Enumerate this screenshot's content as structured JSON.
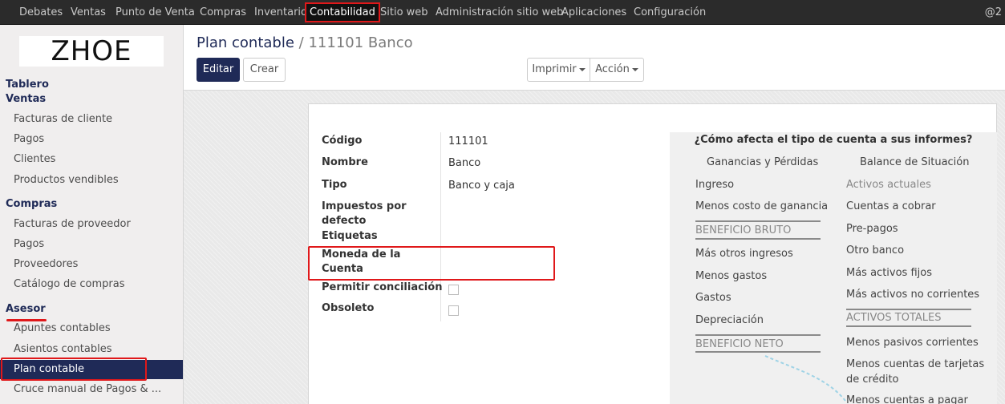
{
  "topbar": {
    "menus": [
      {
        "label": "Debates"
      },
      {
        "label": "Ventas"
      },
      {
        "label": "Punto de Venta"
      },
      {
        "label": "Compras"
      },
      {
        "label": "Inventario"
      },
      {
        "label": "Contabilidad"
      },
      {
        "label": "Sitio web"
      },
      {
        "label": "Administración sitio web"
      },
      {
        "label": "Aplicaciones"
      },
      {
        "label": "Configuración"
      }
    ],
    "user": "@2"
  },
  "sidebar": {
    "logo": "ZHOE",
    "sections": {
      "tablero": "Tablero",
      "ventas": "Ventas",
      "compras": "Compras",
      "asesor": "Asesor"
    },
    "ventas_items": [
      "Facturas de cliente",
      "Pagos",
      "Clientes",
      "Productos vendibles"
    ],
    "compras_items": [
      "Facturas de proveedor",
      "Pagos",
      "Proveedores",
      "Catálogo de compras"
    ],
    "asesor_items": [
      "Apuntes contables",
      "Asientos contables",
      "Plan contable",
      "Cruce manual de Pagos & ..."
    ]
  },
  "breadcrumb": {
    "parent": "Plan contable",
    "sep": "/",
    "current": "111101 Banco"
  },
  "toolbar": {
    "edit": "Editar",
    "create": "Crear",
    "print": "Imprimir",
    "action": "Acción"
  },
  "form": {
    "codigo_label": "Código",
    "codigo_value": "111101",
    "nombre_label": "Nombre",
    "nombre_value": "Banco",
    "tipo_label": "Tipo",
    "tipo_value": "Banco y caja",
    "impuestos_label_1": "Impuestos por",
    "impuestos_label_2": "defecto",
    "etiquetas_label": "Etiquetas",
    "moneda_label_1": "Moneda de la",
    "moneda_label_2": "Cuenta",
    "conciliacion_label": "Permitir conciliación",
    "obsoleto_label": "Obsoleto"
  },
  "info": {
    "title": "¿Cómo afecta el tipo de cuenta a sus informes?",
    "pl_head": "Ganancias y Pérdidas",
    "bs_head": "Balance de Situación",
    "pl_items": [
      "Ingreso",
      "Menos costo de ganancia",
      "BENEFICIO BRUTO",
      "Más otros ingresos",
      "Menos gastos",
      "Gastos",
      "Depreciación",
      "BENEFICIO NETO"
    ],
    "bs_items": [
      "Activos actuales",
      "Cuentas a cobrar",
      "Pre-pagos",
      "Otro banco",
      "Más activos fijos",
      "Más activos no corrientes",
      "ACTIVOS TOTALES",
      "Menos pasivos corrientes",
      "Menos cuentas de tarjetas",
      "de crédito",
      "Menos cuentas a pagar"
    ]
  }
}
